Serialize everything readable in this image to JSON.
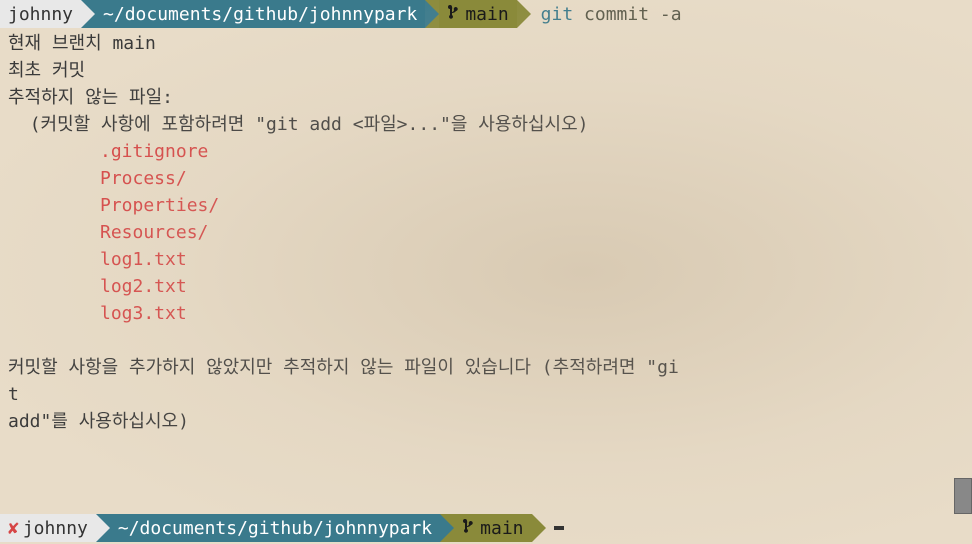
{
  "top_prompt": {
    "user": "johnny",
    "path": "~/documents/github/johnnypark",
    "branch": "main",
    "command_git": "git",
    "command_rest": " commit -a"
  },
  "output": {
    "line1": "현재 브랜치 main",
    "line2": "",
    "line3": "최초 커밋",
    "line4": "",
    "line5": "추적하지 않는 파일:",
    "line6": "  (커밋할 사항에 포함하려면 \"git add <파일>...\"을 사용하십시오)",
    "untracked": [
      ".gitignore",
      "Process/",
      "Properties/",
      "Resources/",
      "log1.txt",
      "log2.txt",
      "log3.txt"
    ],
    "line_final1": "커밋할 사항을 추가하지 않았지만 추적하지 않는 파일이 있습니다 (추적하려면 \"gi",
    "line_final2": "t",
    "line_final3": "add\"를 사용하십시오)"
  },
  "bottom_prompt": {
    "status_icon": "✘",
    "user": "johnny",
    "path": "~/documents/github/johnnypark",
    "branch": "main"
  },
  "icons": {
    "branch": "⎇"
  }
}
